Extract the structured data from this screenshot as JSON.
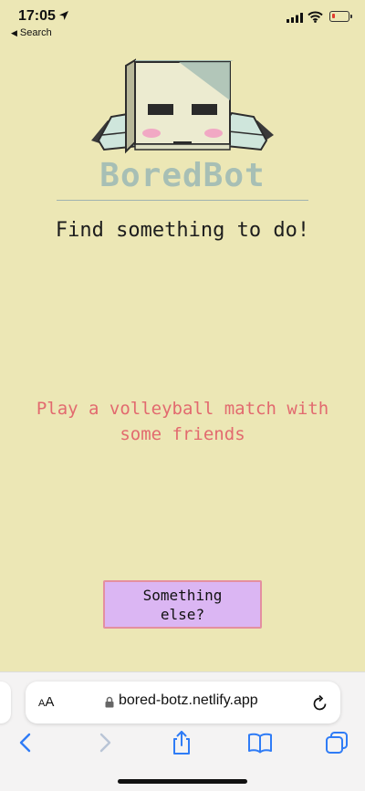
{
  "status_bar": {
    "time": "17:05",
    "back_label": "Search"
  },
  "app": {
    "brand": "BoredBot",
    "tagline": "Find something to do!",
    "activity": "Play a volleyball match with some friends",
    "button_label": "Something else?"
  },
  "browser": {
    "text_size_label_small": "A",
    "text_size_label_large": "A",
    "url": "bored-botz.netlify.app"
  },
  "colors": {
    "background": "#ece7b5",
    "brand": "#a7bfb5",
    "activity": "#e26a6f",
    "button_fill": "#dbb6f3",
    "button_border": "#e48fa0",
    "link_blue": "#2f7cf6"
  },
  "icons": [
    "location-arrow-icon",
    "signal-icon",
    "wifi-icon",
    "battery-icon",
    "robot-logo",
    "lock-icon",
    "reload-icon",
    "back-arrow-icon",
    "forward-arrow-icon",
    "share-icon",
    "bookmarks-icon",
    "tabs-icon"
  ]
}
